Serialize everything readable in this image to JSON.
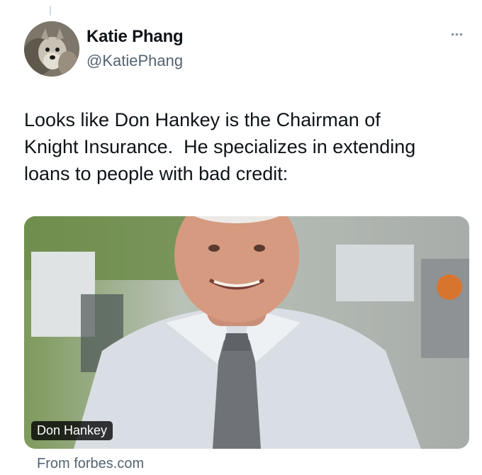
{
  "author": {
    "name": "Katie Phang",
    "handle": "@KatiePhang"
  },
  "tweet": {
    "text": "Looks like Don Hankey is the Chairman of\nKnight Insurance.  He specializes in extending\nloans to people with bad credit:"
  },
  "link_card": {
    "image_label": "Don Hankey",
    "source": "From forbes.com"
  },
  "icons": {
    "more": "more-options-icon",
    "avatar": "avatar-dog-photo"
  },
  "colors": {
    "text": "#0f1419",
    "secondary_text": "#536471"
  }
}
